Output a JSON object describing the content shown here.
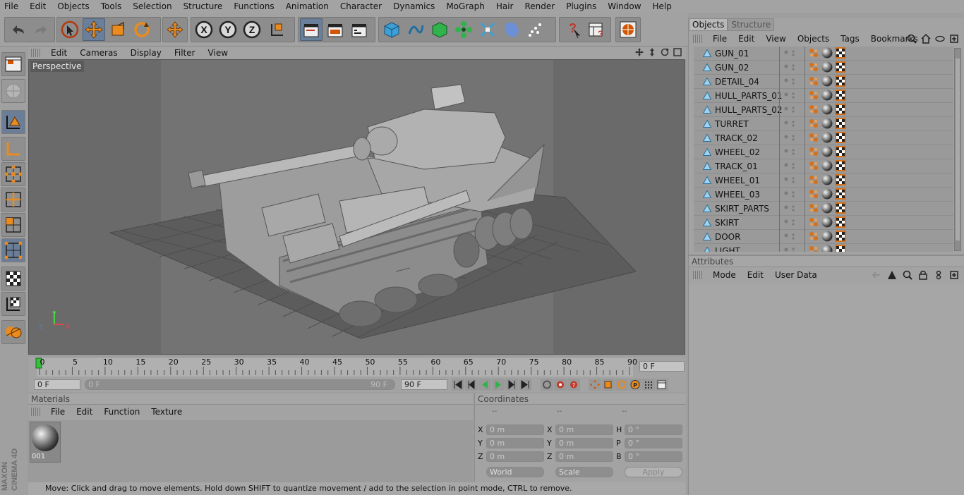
{
  "menu": [
    "File",
    "Edit",
    "Objects",
    "Tools",
    "Selection",
    "Structure",
    "Functions",
    "Animation",
    "Character",
    "Dynamics",
    "MoGraph",
    "Hair",
    "Render",
    "Plugins",
    "Window",
    "Help"
  ],
  "viewport": {
    "menu": [
      "Edit",
      "Cameras",
      "Display",
      "Filter",
      "View"
    ],
    "label": "Perspective"
  },
  "timeline": {
    "ticks": [
      "0",
      "5",
      "10",
      "15",
      "20",
      "25",
      "30",
      "35",
      "40",
      "45",
      "50",
      "55",
      "60",
      "65",
      "70",
      "75",
      "80",
      "85",
      "90"
    ],
    "current_frame": "0 F",
    "start": "0 F",
    "range_start": "0 F",
    "range_end": "90 F",
    "end": "90 F"
  },
  "materials": {
    "title": "Materials",
    "menu": [
      "File",
      "Edit",
      "Function",
      "Texture"
    ],
    "items": [
      {
        "name": "001"
      }
    ]
  },
  "coordinates": {
    "title": "Coordinates",
    "col_headers": [
      "--",
      "--",
      "--"
    ],
    "rows": [
      {
        "l1": "X",
        "v1": "0 m",
        "l2": "X",
        "v2": "0 m",
        "l3": "H",
        "v3": "0 °"
      },
      {
        "l1": "Y",
        "v1": "0 m",
        "l2": "Y",
        "v2": "0 m",
        "l3": "P",
        "v3": "0 °"
      },
      {
        "l1": "Z",
        "v1": "0 m",
        "l2": "Z",
        "v2": "0 m",
        "l3": "B",
        "v3": "0 °"
      }
    ],
    "mode_select": "World",
    "size_select": "Scale",
    "apply": "Apply"
  },
  "status": "Move: Click and drag to move elements. Hold down SHIFT to quantize movement / add to the selection in point mode, CTRL to remove.",
  "objects_panel": {
    "tabs": [
      "Objects",
      "Structure"
    ],
    "menu": [
      "File",
      "Edit",
      "View",
      "Objects",
      "Tags",
      "Bookmarks"
    ],
    "items": [
      "GUN_01",
      "GUN_02",
      "DETAIL_04",
      "HULL_PARTS_01",
      "HULL_PARTS_02",
      "TURRET",
      "TRACK_02",
      "WHEEL_02",
      "TRACK_01",
      "WHEEL_01",
      "WHEEL_03",
      "SKIRT_PARTS",
      "SKIRT",
      "DOOR",
      "LIGHT"
    ]
  },
  "attributes_panel": {
    "title": "Attributes",
    "menu": [
      "Mode",
      "Edit",
      "User Data"
    ]
  },
  "branding": "MAXON CINEMA 4D",
  "colors": {
    "accent_orange": "#e07a1f",
    "selected_blue": "#6a7f99",
    "bg_gray": "#a3a3a3"
  }
}
